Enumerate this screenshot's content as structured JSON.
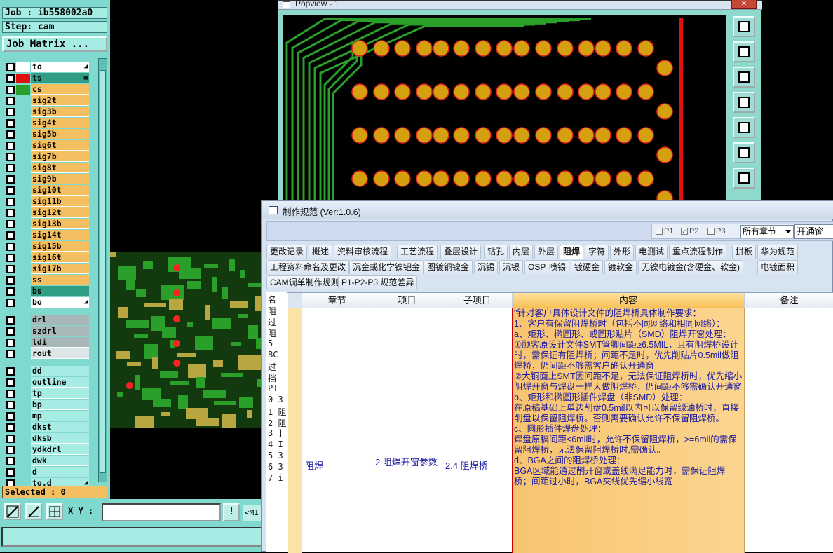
{
  "left_panel": {
    "job_label": "Job : ib558002a0",
    "step_label": "Step: cam",
    "job_matrix_button": "Job Matrix ...",
    "selected_label": "Selected : 0",
    "layers": [
      {
        "name": "to",
        "color": "#ffffff",
        "swatch": "#ffffff",
        "suffix": "◢"
      },
      {
        "name": "ts",
        "color": "#2f9e84",
        "swatch": "#e01010",
        "suffix": "▦"
      },
      {
        "name": "cs",
        "color": "#f3bf60",
        "swatch": "#2aa02a",
        "suffix": ""
      },
      {
        "name": "sig2t",
        "color": "#f3bf60",
        "swatch": "",
        "suffix": ""
      },
      {
        "name": "sig3b",
        "color": "#f3bf60",
        "swatch": "",
        "suffix": ""
      },
      {
        "name": "sig4t",
        "color": "#f3bf60",
        "swatch": "",
        "suffix": ""
      },
      {
        "name": "sig5b",
        "color": "#f3bf60",
        "swatch": "",
        "suffix": ""
      },
      {
        "name": "sig6t",
        "color": "#f3bf60",
        "swatch": "",
        "suffix": ""
      },
      {
        "name": "sig7b",
        "color": "#f3bf60",
        "swatch": "",
        "suffix": ""
      },
      {
        "name": "sig8t",
        "color": "#f3bf60",
        "swatch": "",
        "suffix": ""
      },
      {
        "name": "sig9b",
        "color": "#f3bf60",
        "swatch": "",
        "suffix": ""
      },
      {
        "name": "sig10t",
        "color": "#f3bf60",
        "swatch": "",
        "suffix": ""
      },
      {
        "name": "sig11b",
        "color": "#f3bf60",
        "swatch": "",
        "suffix": ""
      },
      {
        "name": "sig12t",
        "color": "#f3bf60",
        "swatch": "",
        "suffix": ""
      },
      {
        "name": "sig13b",
        "color": "#f3bf60",
        "swatch": "",
        "suffix": ""
      },
      {
        "name": "sig14t",
        "color": "#f3bf60",
        "swatch": "",
        "suffix": ""
      },
      {
        "name": "sig15b",
        "color": "#f3bf60",
        "swatch": "",
        "suffix": ""
      },
      {
        "name": "sig16t",
        "color": "#f3bf60",
        "swatch": "",
        "suffix": ""
      },
      {
        "name": "sig17b",
        "color": "#f3bf60",
        "swatch": "",
        "suffix": ""
      },
      {
        "name": "ss",
        "color": "#f3bf60",
        "swatch": "",
        "suffix": ""
      },
      {
        "name": "bs",
        "color": "#2f9e84",
        "swatch": "",
        "suffix": ""
      },
      {
        "name": "bo",
        "color": "#ffffff",
        "swatch": "",
        "suffix": "◢"
      }
    ],
    "drill_layers": [
      {
        "name": "drl",
        "color": "#a8b8b8"
      },
      {
        "name": "szdrl",
        "color": "#a8b8b8"
      },
      {
        "name": "ldi",
        "color": "#a8b8b8"
      },
      {
        "name": "rout",
        "color": "#dde6e6"
      }
    ],
    "misc_layers": [
      {
        "name": "dd",
        "color": "#a6ece4"
      },
      {
        "name": "outline",
        "color": "#a6ece4"
      },
      {
        "name": "tp",
        "color": "#a6ece4"
      },
      {
        "name": "bp",
        "color": "#a6ece4"
      },
      {
        "name": "mp",
        "color": "#a6ece4"
      },
      {
        "name": "dkst",
        "color": "#a6ece4"
      },
      {
        "name": "dksb",
        "color": "#a6ece4"
      },
      {
        "name": "ydkdrl",
        "color": "#a6ece4"
      },
      {
        "name": "dwk",
        "color": "#a6ece4"
      },
      {
        "name": "d",
        "color": "#a6ece4"
      },
      {
        "name": "to.d",
        "color": "#a6ece4",
        "suffix": "◢"
      }
    ]
  },
  "bottom_bar": {
    "xy_label": "X Y :",
    "xy_value": "",
    "m_label": "<M1"
  },
  "popview": {
    "title": "Popview - 1",
    "close": "✕"
  },
  "spec_window": {
    "title": "制作规范 (Ver:1.0.6)",
    "filters": [
      {
        "label": "P1",
        "checked": false
      },
      {
        "label": "P2",
        "checked": true
      },
      {
        "label": "P3",
        "checked": false
      }
    ],
    "chapter_select": "所有章节",
    "search_value": "开通窗",
    "tabs_row1": [
      "更改记录",
      "概述",
      "资料审核流程",
      "工艺流程",
      "叠层设计",
      "钻孔",
      "内层",
      "外层",
      "阻焊",
      "字符",
      "外形",
      "电测试",
      "重点流程制作",
      "拼板",
      "华为规范"
    ],
    "active_tab": "阻焊",
    "tabs_row2": [
      "工程资料命名及更改",
      "沉金或化学镍钯金",
      "图镀铜镍金",
      "沉锡",
      "沉银",
      "OSP",
      "喷锡",
      "镀硬金",
      "镀软金",
      "无镍电镀金(含硬金、软金)",
      "电镀面积"
    ],
    "tabs_row3": [
      "CAM调单制作规则",
      "P1-P2-P3 规范差异"
    ],
    "left_strip_lines": [
      "名",
      "阻",
      "过",
      "阻",
      "5",
      "BC",
      "过",
      "挡",
      "PT",
      "0 3",
      "1 阻",
      "2 阻",
      "3 ]",
      "4 I",
      "5 3",
      "6 3",
      "7 i"
    ],
    "columns": [
      "章节",
      "项目",
      "子项目",
      "内容",
      "备注"
    ],
    "row": {
      "chapter": "阻焊",
      "item": "2 阻焊开窗参数",
      "subitem": "2.4 阻焊桥",
      "content": [
        "\"针对客户具体设计文件的阻焊桥具体制作要求：",
        "1、客户有保留阻焊桥时（包括不同网络和相同网络）：",
        "a、矩形、椭圆形、或圆形贴片（SMD）阻焊开窗处理：",
        "①顾客原设计文件SMT管脚间距≥6.5MIL，且有阻焊桥设计时，需保证有阻焊桥；间距不足时，优先削贴片0.5mil做阻焊桥，仍间距不够需客户确认开通窗",
        "②大铜面上SMT因间距不足，无法保证阻焊桥时，优先缩小阻焊开窗与焊盘一样大做阻焊桥，仍间距不够需确认开通窗",
        "b、矩形和椭圆形插件焊盘（非SMD）处理：",
        "在原稿基础上单边削盘0.5mil以内可以保留绿油桥时，直接削盘以保留阻焊桥。否则需要确认允许不保留阻焊桥。",
        "c、圆形插件焊盘处理：",
        "焊盘原稿间距<6mil时，允许不保留阻焊桥，>=6mil的需保留阻焊桥，无法保留阻焊桥时,需确认。",
        "d、BGA之间的阻焊桥处理：",
        "BGA区域能通过削开窗或盖线满足能力时，需保证阻焊桥；间距过小时，BGA夹线优先缩小线宽"
      ],
      "remark": ""
    }
  },
  "colors": {
    "panel_bg": "#7fd9cf",
    "pad_fill": "#d4a010",
    "pad_ring": "#e02020",
    "trace": "#2aa02a",
    "content_highlight": "#f8c158"
  }
}
